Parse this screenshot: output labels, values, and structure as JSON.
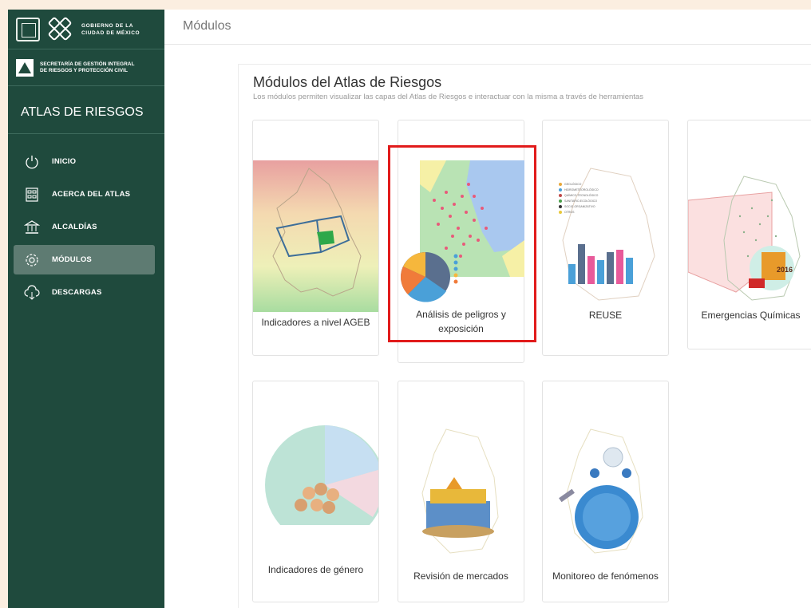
{
  "sidebar": {
    "gobierno_line1": "GOBIERNO DE LA",
    "gobierno_line2": "CIUDAD DE MÉXICO",
    "secretaria_line1": "SECRETARÍA DE GESTIÓN INTEGRAL",
    "secretaria_line2": "DE RIESGOS Y PROTECCIÓN CIVIL",
    "app_title": "ATLAS DE RIESGOS",
    "nav": [
      {
        "label": "INICIO",
        "icon": "power-icon"
      },
      {
        "label": "ACERCA DEL ATLAS",
        "icon": "document-icon"
      },
      {
        "label": "ALCALDÍAS",
        "icon": "building-icon"
      },
      {
        "label": "MÓDULOS",
        "icon": "gear-icon",
        "active": true
      },
      {
        "label": "DESCARGAS",
        "icon": "cloud-download-icon"
      }
    ]
  },
  "header": {
    "title": "Módulos"
  },
  "main": {
    "title": "Módulos del Atlas de Riesgos",
    "subtitle": "Los módulos permiten visualizar las capas del Atlas de Riesgos e interactuar con la misma a través de herramientas",
    "modules": [
      {
        "line1": "Indicadores a nivel AGEB",
        "line2": ""
      },
      {
        "line1": "Análisis de peligros y",
        "line2": "exposición"
      },
      {
        "line1": "REUSE",
        "line2": ""
      },
      {
        "line1": "Emergencias Químicas",
        "line2": ""
      },
      {
        "line1": "Indicadores de género",
        "line2": ""
      },
      {
        "line1": "Revisión de mercados",
        "line2": ""
      },
      {
        "line1": "Monitoreo de fenómenos",
        "line2": ""
      }
    ],
    "reuse_legend": [
      "GEOLÓGICO",
      "HIDROMETEOROLÓGICO",
      "QUÍMICO-TECNOLÓGICO",
      "SANITARIO-ECOLÓGICO",
      "SOCIO-ORGANIZATIVO",
      "OTROS"
    ],
    "quimicas_year": "2016"
  },
  "colors": {
    "sidebar": "#1f4a3d",
    "highlight": "#e11b1b",
    "active_nav": "#5e7b72"
  }
}
